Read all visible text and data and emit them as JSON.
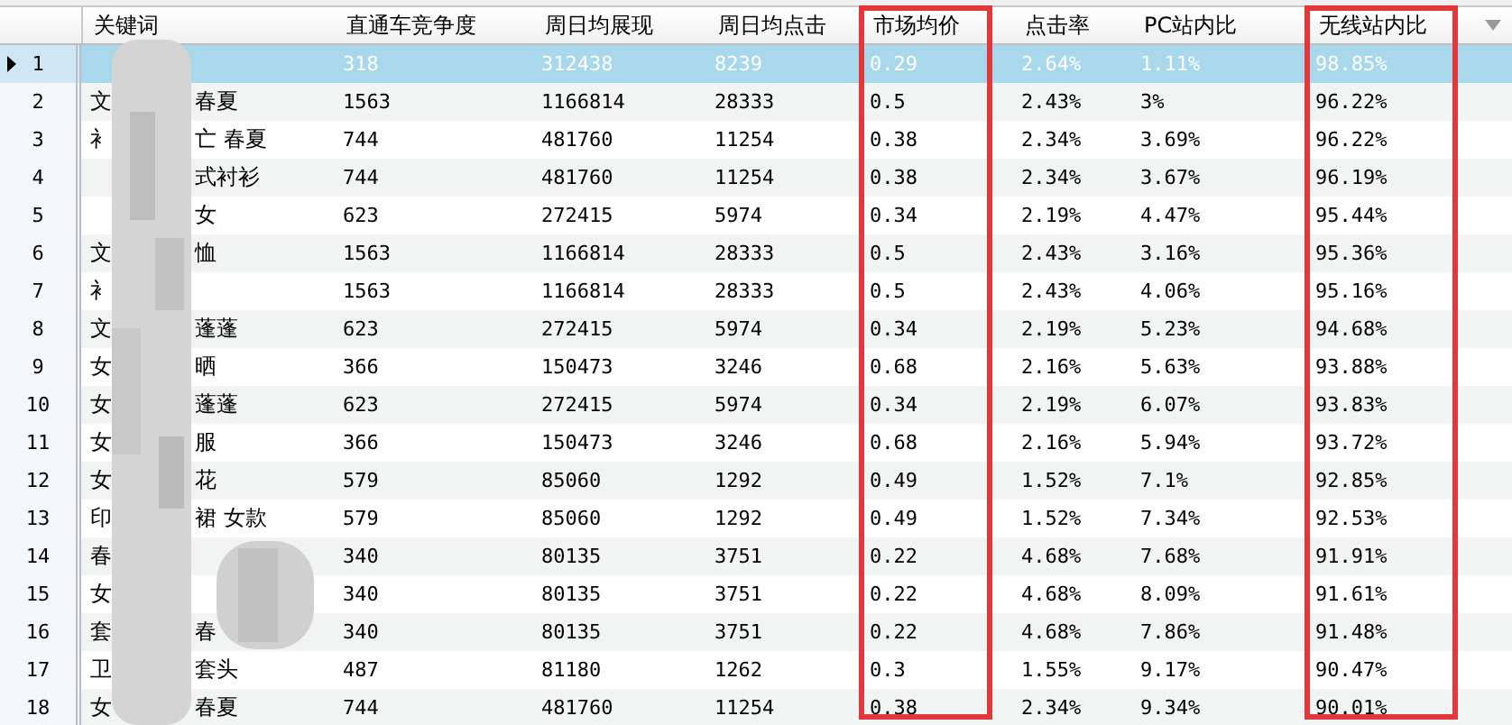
{
  "table": {
    "keyword_header": "关键词",
    "columns": [
      {
        "label": "直通车竞争度",
        "highlighted": false
      },
      {
        "label": "周日均展现",
        "highlighted": false
      },
      {
        "label": "周日均点击",
        "highlighted": false
      },
      {
        "label": "市场均价",
        "highlighted": true
      },
      {
        "label": "点击率",
        "highlighted": false
      },
      {
        "label": "PC站内比",
        "highlighted": false
      },
      {
        "label": "无线站内比",
        "highlighted": true
      }
    ],
    "rows": [
      {
        "index": "1",
        "selected": true,
        "keyword_start": "",
        "keyword_end": "",
        "cells": [
          "318",
          "312438",
          "8239",
          "0.29",
          "2.64%",
          "1.11%",
          "98.85%"
        ]
      },
      {
        "index": "2",
        "selected": false,
        "keyword_start": "文",
        "keyword_end": "春夏",
        "cells": [
          "1563",
          "1166814",
          "28333",
          "0.5",
          "2.43%",
          "3%",
          "96.22%"
        ]
      },
      {
        "index": "3",
        "selected": false,
        "keyword_start": "衤",
        "keyword_end": "亡 春夏",
        "cells": [
          "744",
          "481760",
          "11254",
          "0.38",
          "2.34%",
          "3.69%",
          "96.22%"
        ]
      },
      {
        "index": "4",
        "selected": false,
        "keyword_start": "",
        "keyword_end": "式衬衫",
        "cells": [
          "744",
          "481760",
          "11254",
          "0.38",
          "2.34%",
          "3.67%",
          "96.19%"
        ]
      },
      {
        "index": "5",
        "selected": false,
        "keyword_start": "",
        "keyword_end": "女",
        "cells": [
          "623",
          "272415",
          "5974",
          "0.34",
          "2.19%",
          "4.47%",
          "95.44%"
        ]
      },
      {
        "index": "6",
        "selected": false,
        "keyword_start": "文",
        "keyword_end": "恤",
        "cells": [
          "1563",
          "1166814",
          "28333",
          "0.5",
          "2.43%",
          "3.16%",
          "95.36%"
        ]
      },
      {
        "index": "7",
        "selected": false,
        "keyword_start": "衤",
        "keyword_end": "",
        "cells": [
          "1563",
          "1166814",
          "28333",
          "0.5",
          "2.43%",
          "4.06%",
          "95.16%"
        ]
      },
      {
        "index": "8",
        "selected": false,
        "keyword_start": "文",
        "keyword_end": "蓬蓬",
        "cells": [
          "623",
          "272415",
          "5974",
          "0.34",
          "2.19%",
          "5.23%",
          "94.68%"
        ]
      },
      {
        "index": "9",
        "selected": false,
        "keyword_start": "女",
        "keyword_end": "晒",
        "cells": [
          "366",
          "150473",
          "3246",
          "0.68",
          "2.16%",
          "5.63%",
          "93.88%"
        ]
      },
      {
        "index": "10",
        "selected": false,
        "keyword_start": "女",
        "keyword_end": "蓬蓬",
        "cells": [
          "623",
          "272415",
          "5974",
          "0.34",
          "2.19%",
          "6.07%",
          "93.83%"
        ]
      },
      {
        "index": "11",
        "selected": false,
        "keyword_start": "女",
        "keyword_end": "服",
        "cells": [
          "366",
          "150473",
          "3246",
          "0.68",
          "2.16%",
          "5.94%",
          "93.72%"
        ]
      },
      {
        "index": "12",
        "selected": false,
        "keyword_start": "女",
        "keyword_end": "花",
        "cells": [
          "579",
          "85060",
          "1292",
          "0.49",
          "1.52%",
          "7.1%",
          "92.85%"
        ]
      },
      {
        "index": "13",
        "selected": false,
        "keyword_start": "印",
        "keyword_end": "裙 女款",
        "cells": [
          "579",
          "85060",
          "1292",
          "0.49",
          "1.52%",
          "7.34%",
          "92.53%"
        ]
      },
      {
        "index": "14",
        "selected": false,
        "keyword_start": "春",
        "keyword_end": "",
        "cells": [
          "340",
          "80135",
          "3751",
          "0.22",
          "4.68%",
          "7.68%",
          "91.91%"
        ]
      },
      {
        "index": "15",
        "selected": false,
        "keyword_start": "女",
        "keyword_end": "",
        "cells": [
          "340",
          "80135",
          "3751",
          "0.22",
          "4.68%",
          "8.09%",
          "91.61%"
        ]
      },
      {
        "index": "16",
        "selected": false,
        "keyword_start": "套",
        "keyword_end": "春",
        "cells": [
          "340",
          "80135",
          "3751",
          "0.22",
          "4.68%",
          "7.86%",
          "91.48%"
        ]
      },
      {
        "index": "17",
        "selected": false,
        "keyword_start": "卫",
        "keyword_end": "套头",
        "cells": [
          "487",
          "81180",
          "1262",
          "0.3",
          "1.55%",
          "9.17%",
          "90.47%"
        ]
      },
      {
        "index": "18",
        "selected": false,
        "keyword_start": "女",
        "keyword_end": "春夏",
        "cells": [
          "744",
          "481760",
          "11254",
          "0.38",
          "2.34%",
          "9.34%",
          "90.01%"
        ]
      }
    ]
  }
}
